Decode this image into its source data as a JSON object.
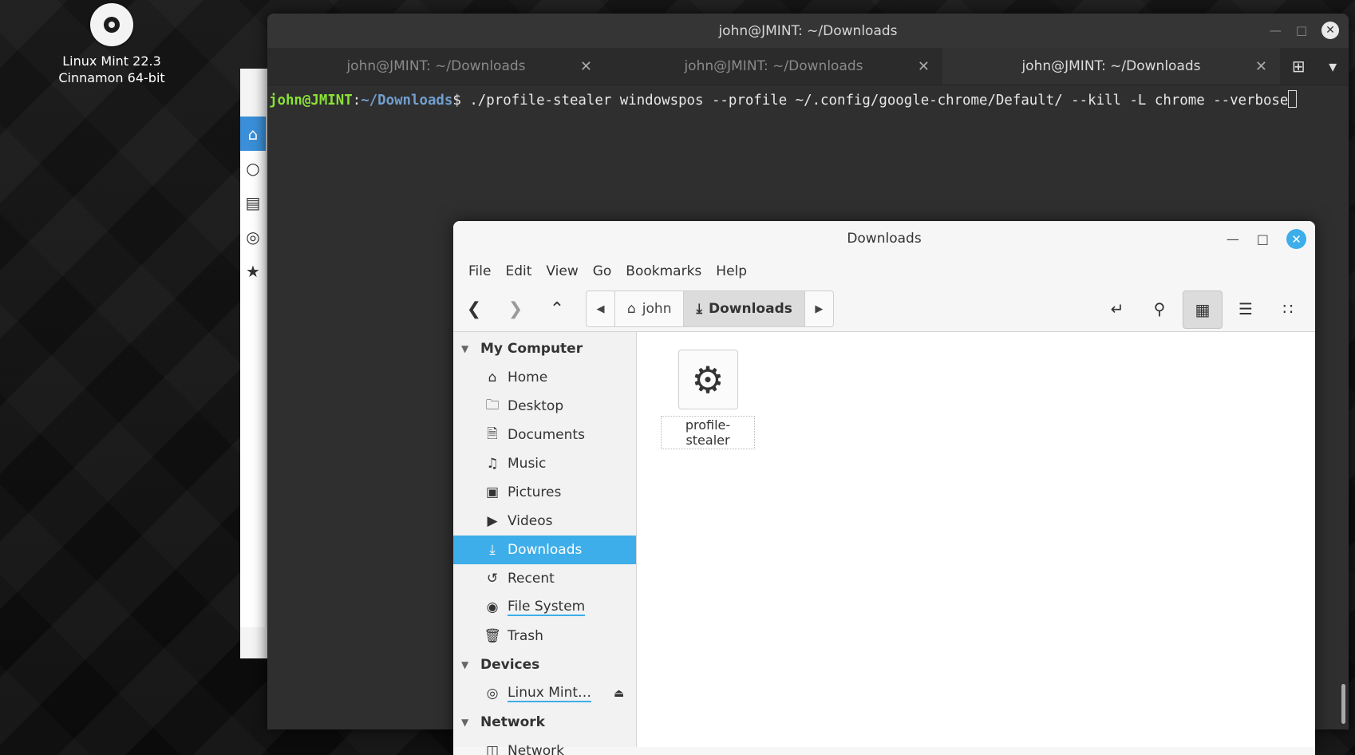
{
  "desktop": {
    "icon_line1": "Linux Mint 22.3",
    "icon_line2": "Cinnamon 64-bit"
  },
  "terminal": {
    "title": "john@JMINT: ~/Downloads",
    "tabs": [
      {
        "label": "john@JMINT: ~/Downloads",
        "active": false
      },
      {
        "label": "john@JMINT: ~/Downloads",
        "active": false
      },
      {
        "label": "john@JMINT: ~/Downloads",
        "active": true
      }
    ],
    "prompt_user": "john@JMINT",
    "prompt_sep": ":",
    "prompt_path": "~/Downloads",
    "prompt_symbol": "$ ",
    "command": "./profile-stealer windowspos --profile ~/.config/google-chrome/Default/ --kill -L chrome --verbose"
  },
  "file_manager": {
    "title": "Downloads",
    "menu": [
      "File",
      "Edit",
      "View",
      "Go",
      "Bookmarks",
      "Help"
    ],
    "path": {
      "home": "john",
      "current": "Downloads"
    },
    "sidebar": {
      "my_computer": "My Computer",
      "items": [
        {
          "label": "Home",
          "icon": "home-icon"
        },
        {
          "label": "Desktop",
          "icon": "folder-icon"
        },
        {
          "label": "Documents",
          "icon": "document-icon"
        },
        {
          "label": "Music",
          "icon": "music-icon"
        },
        {
          "label": "Pictures",
          "icon": "picture-icon"
        },
        {
          "label": "Videos",
          "icon": "video-icon"
        },
        {
          "label": "Downloads",
          "icon": "download-icon"
        },
        {
          "label": "Recent",
          "icon": "recent-icon"
        },
        {
          "label": "File System",
          "icon": "drive-icon"
        },
        {
          "label": "Trash",
          "icon": "trash-icon"
        }
      ],
      "devices": "Devices",
      "device_item": "Linux Mint…",
      "network": "Network",
      "network_item": "Network"
    },
    "files": [
      {
        "name": "profile-stealer",
        "icon": "gear-icon"
      }
    ],
    "accent": "#3daee9"
  }
}
